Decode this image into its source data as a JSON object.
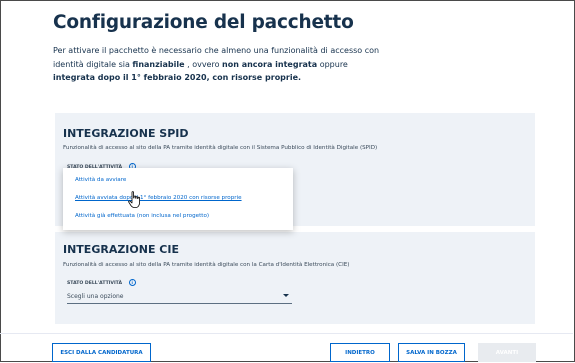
{
  "page": {
    "title": "Configurazione del pacchetto",
    "intro": {
      "p1": "Per attivare il pacchetto è necessario che almeno una funzionalità di accesso con identità digitale sia ",
      "b1": "finanziabile",
      "p2": " , ovvero ",
      "b2": "non ancora integrata",
      "p3": " oppure ",
      "b3": "integrata dopo il 1° febbraio 2020, con risorse proprie."
    }
  },
  "spid": {
    "title": "INTEGRAZIONE SPID",
    "description": "Funzionalità di accesso al sito della PA tramite identità digitale con il Sistema Pubblico di Identità Digitale (SPID)",
    "field_label": "STATO DELL'ATTIVITÀ",
    "info_glyph": "i",
    "dropdown_options": [
      "Attività da avviare",
      "Attività avviata dopo il 1° febbraio 2020 con risorse proprie",
      "Attività già effettuata (non inclusa nel progetto)"
    ]
  },
  "cie": {
    "title": "INTEGRAZIONE CIE",
    "description": "Funzionalità di accesso al sito della PA tramite identità digitale con la Carta d'Identità Elettronica (CIE)",
    "field_label": "STATO DELL'ATTIVITÀ",
    "info_glyph": "i",
    "select_value": "Scegli una opzione"
  },
  "footer": {
    "exit_label": "ESCI DALLA CANDIDATURA",
    "back_label": "INDIETRO",
    "save_draft_label": "SALVA IN BOZZA",
    "next_label": "AVANTI"
  },
  "colors": {
    "primary": "#0066cc",
    "heading": "#17324d",
    "card_bg": "#eef2f7"
  },
  "icons": {
    "info": "info-icon",
    "caret": "chevron-down-icon",
    "cursor": "hand-pointer-icon"
  }
}
